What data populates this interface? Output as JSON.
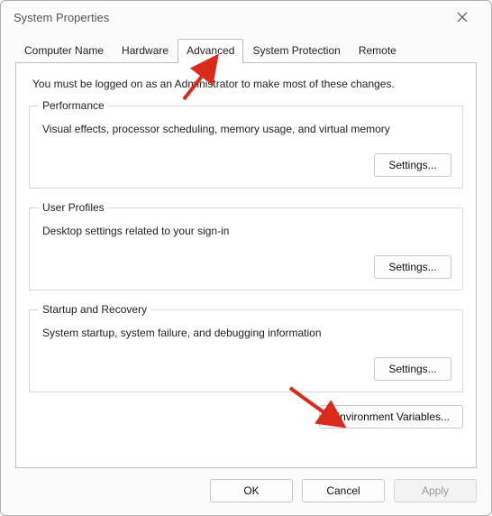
{
  "window": {
    "title": "System Properties"
  },
  "tabs": {
    "computer_name": "Computer Name",
    "hardware": "Hardware",
    "advanced": "Advanced",
    "system_protection": "System Protection",
    "remote": "Remote",
    "active": "advanced"
  },
  "intro_text": "You must be logged on as an Administrator to make most of these changes.",
  "groups": {
    "performance": {
      "legend": "Performance",
      "desc": "Visual effects, processor scheduling, memory usage, and virtual memory",
      "button": "Settings..."
    },
    "user_profiles": {
      "legend": "User Profiles",
      "desc": "Desktop settings related to your sign-in",
      "button": "Settings..."
    },
    "startup_recovery": {
      "legend": "Startup and Recovery",
      "desc": "System startup, system failure, and debugging information",
      "button": "Settings..."
    }
  },
  "env_button": "Environment Variables...",
  "dialog_buttons": {
    "ok": "OK",
    "cancel": "Cancel",
    "apply": "Apply"
  },
  "annotations": {
    "arrow_color": "#d92a1c"
  }
}
